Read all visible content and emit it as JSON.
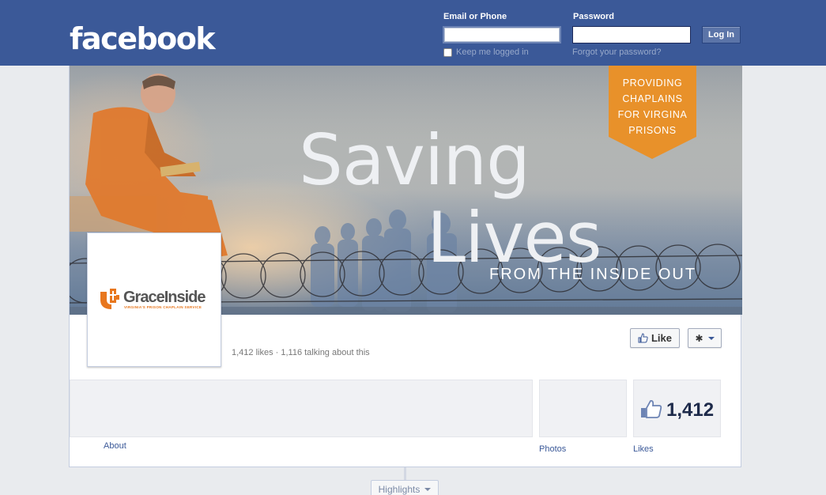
{
  "header": {
    "logo": "facebook",
    "email_label": "Email or Phone",
    "password_label": "Password",
    "email_value": "",
    "password_value": "",
    "login_button": "Log In",
    "keep_logged_in": "Keep me logged in",
    "forgot_password": "Forgot your password?"
  },
  "cover": {
    "badge_lines": [
      "PROVIDING",
      "CHAPLAINS",
      "FOR VIRGINA",
      "PRISONS"
    ],
    "headline_1": "Saving",
    "headline_2": "Lives",
    "tagline": "FROM THE INSIDE OUT",
    "badge_color": "#e8912a"
  },
  "profile": {
    "brand": "GraceInside",
    "brand_sub": "VIRGINIA'S PRISON CHAPLAIN SERVICE",
    "brand_color": "#e8771e"
  },
  "page": {
    "stats": "1,412 likes · 1,116 talking about this",
    "like_button": "Like",
    "gear_icon": "gear-icon"
  },
  "sections": {
    "about": "About",
    "photos": "Photos",
    "likes": "Likes",
    "likes_count": "1,412"
  },
  "timeline": {
    "highlights": "Highlights"
  },
  "colors": {
    "brand_blue": "#3b5998",
    "link": "#3b5998"
  }
}
